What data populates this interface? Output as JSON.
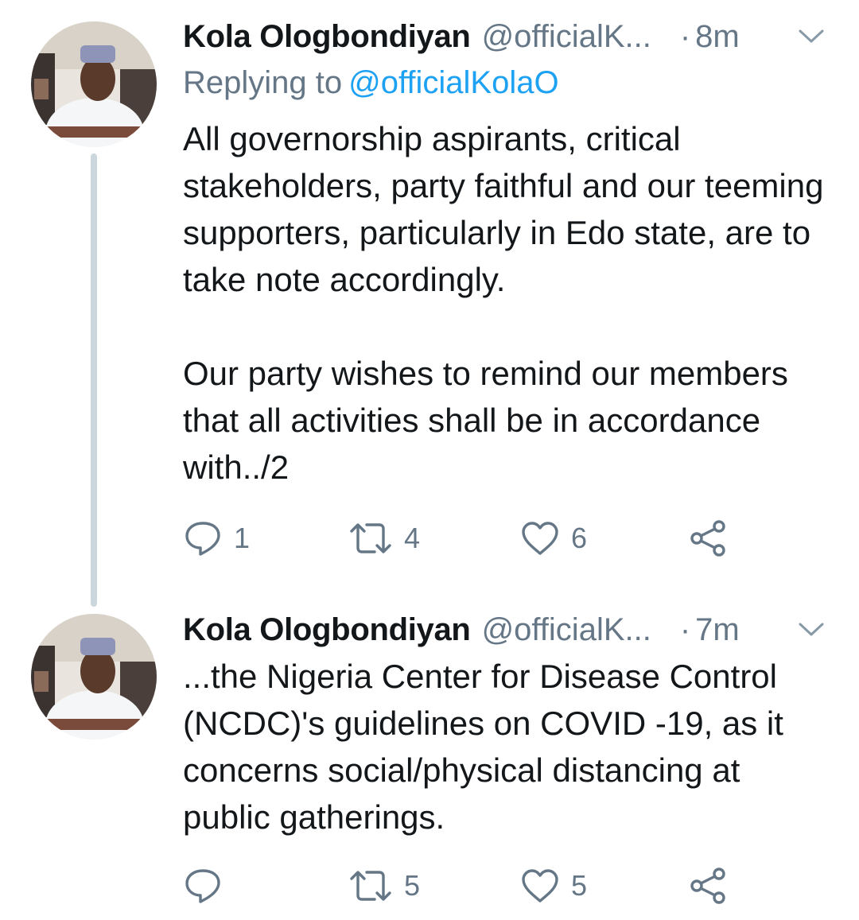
{
  "tweets": [
    {
      "author_name": "Kola Ologbondiyan",
      "handle": "@officialK...",
      "separator": "·",
      "time": "8m",
      "replying_label": "Replying to",
      "replying_handle": "@officialKolaO",
      "text": "All governorship aspirants, critical stakeholders, party faithful and our teeming supporters, particularly in Edo state, are to take note accordingly.\n\nOur party wishes to remind our members that all activities shall be in accordance with../2",
      "reply_count": "1",
      "retweet_count": "4",
      "like_count": "6"
    },
    {
      "author_name": "Kola Ologbondiyan",
      "handle": "@officialK...",
      "separator": "·",
      "time": "7m",
      "text": "...the Nigeria Center for Disease Control (NCDC)'s guidelines on COVID -19, as it concerns social/physical distancing at public gatherings.",
      "reply_count": "",
      "retweet_count": "5",
      "like_count": "5"
    }
  ],
  "icons": {
    "reply": "reply-icon",
    "retweet": "retweet-icon",
    "like": "heart-icon",
    "share": "share-icon",
    "caret": "chevron-down-icon",
    "avatar": "avatar"
  },
  "colors": {
    "text": "#14171a",
    "muted": "#657786",
    "link": "#1da1f2",
    "thread_line": "#ccd6dd"
  }
}
